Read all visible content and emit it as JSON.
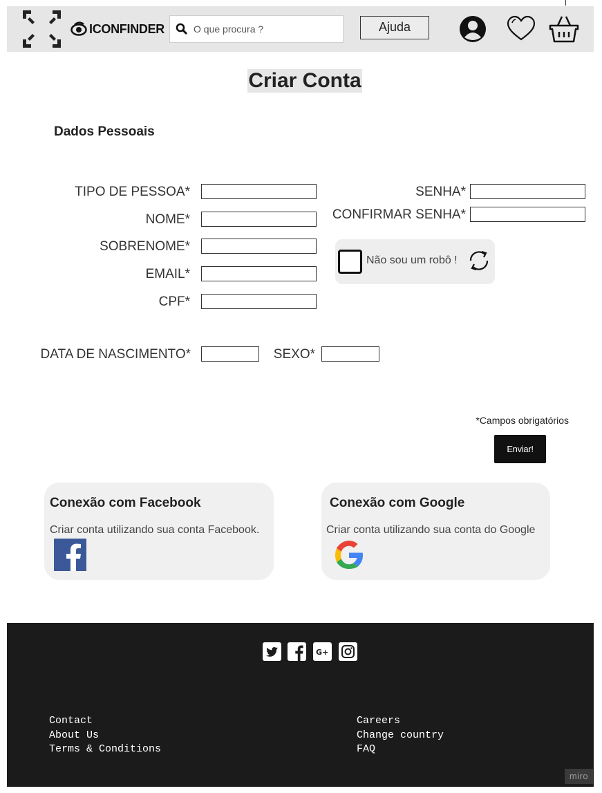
{
  "header": {
    "logo_text": "ICONFINDER",
    "search_placeholder": "O que procura ?",
    "help_label": "Ajuda"
  },
  "page_title": "Criar Conta",
  "section_title": "Dados Pessoais",
  "form": {
    "left_fields": [
      {
        "label": "TIPO DE PESSOA*"
      },
      {
        "label": "NOME*"
      },
      {
        "label": "SOBRENOME*"
      },
      {
        "label": "EMAIL*"
      },
      {
        "label": "CPF*"
      }
    ],
    "right_fields": [
      {
        "label": "SENHA*"
      },
      {
        "label": "CONFIRMAR SENHA*"
      }
    ],
    "birth_label": "DATA DE NASCIMENTO*",
    "sex_label": "SEXO*",
    "captcha_label": "Não sou um robô !",
    "required_note": "*Campos obrigatórios",
    "submit_label": "Enviar!"
  },
  "facebook_card": {
    "title": "Conexão com Facebook",
    "text": "Criar conta utilizando sua conta Facebook."
  },
  "google_card": {
    "title": "Conexão com Google",
    "text": "Criar conta utilizando sua conta do Google"
  },
  "footer": {
    "social_icons": [
      "twitter-icon",
      "facebook-icon",
      "google-plus-icon",
      "instagram-icon"
    ],
    "links_left": [
      "Contact",
      "About Us",
      "Terms & Conditions"
    ],
    "links_right": [
      "Careers",
      "Change country",
      "FAQ"
    ],
    "badge": "miro"
  },
  "colors": {
    "header_bg": "#e6e6e6",
    "footer_bg": "#1b1b1b",
    "button_dark": "#111111",
    "facebook_blue": "#3b5998"
  }
}
